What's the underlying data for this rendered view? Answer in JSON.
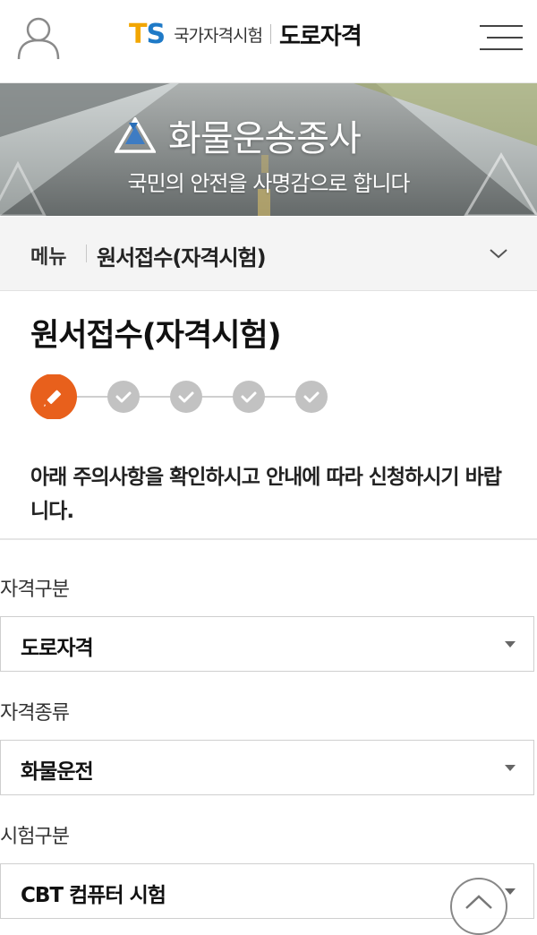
{
  "header": {
    "logo_t": "T",
    "logo_s": "S",
    "org_name": "국가자격시험",
    "site_name": "도로자격"
  },
  "banner": {
    "title": "화물운송종사",
    "subtitle": "국민의 안전을 사명감으로 합니다"
  },
  "breadcrumb": {
    "menu_label": "메뉴",
    "current": "원서접수(자격시험)"
  },
  "page": {
    "title": "원서접수(자격시험)",
    "steps_total": 5,
    "current_step": 1,
    "notice": "아래 주의사항을 확인하시고 안내에 따라 신청하시기 바랍니다."
  },
  "form": {
    "qualification_type": {
      "label": "자격구분",
      "value": "도로자격"
    },
    "qualification_kind": {
      "label": "자격종류",
      "value": "화물운전"
    },
    "exam_type": {
      "label": "시험구분",
      "value": "CBT 컴퓨터 시험"
    }
  },
  "colors": {
    "accent": "#e8601c",
    "step_inactive": "#c2c2c2",
    "logo_t": "#f2a600",
    "logo_s": "#1f7ac7"
  },
  "icons": {
    "user": "user-outline-icon",
    "menu": "hamburger-menu-icon",
    "current_step": "pencil-icon",
    "pending_step": "checkmark-icon",
    "scroll_top": "chevron-up-icon"
  }
}
